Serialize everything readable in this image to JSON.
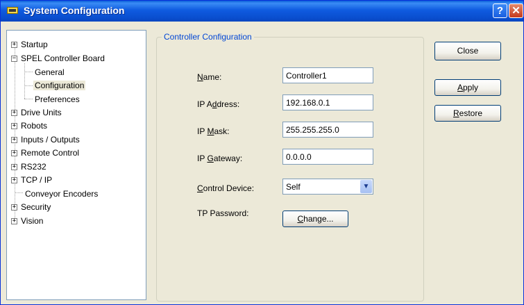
{
  "window": {
    "title": "System Configuration"
  },
  "tree": {
    "items": [
      {
        "label": "Startup",
        "expander": "+"
      },
      {
        "label": "SPEL Controller Board",
        "expander": "−"
      },
      {
        "label": "General"
      },
      {
        "label": "Configuration",
        "selected": true
      },
      {
        "label": "Preferences"
      },
      {
        "label": "Drive Units",
        "expander": "+"
      },
      {
        "label": "Robots",
        "expander": "+"
      },
      {
        "label": "Inputs / Outputs",
        "expander": "+"
      },
      {
        "label": "Remote Control",
        "expander": "+"
      },
      {
        "label": "RS232",
        "expander": "+"
      },
      {
        "label": "TCP / IP",
        "expander": "+"
      },
      {
        "label": "Conveyor Encoders"
      },
      {
        "label": "Security",
        "expander": "+"
      },
      {
        "label": "Vision",
        "expander": "+"
      }
    ]
  },
  "group": {
    "title": "Controller Configuration",
    "fields": {
      "name": {
        "label_pre": "",
        "label_u": "N",
        "label_post": "ame:",
        "value": "Controller1"
      },
      "ip_address": {
        "label_pre": "IP A",
        "label_u": "d",
        "label_post": "dress:",
        "value": "192.168.0.1"
      },
      "ip_mask": {
        "label_pre": "IP ",
        "label_u": "M",
        "label_post": "ask:",
        "value": "255.255.255.0"
      },
      "ip_gateway": {
        "label_pre": "IP ",
        "label_u": "G",
        "label_post": "ateway:",
        "value": "0.0.0.0"
      },
      "control_device": {
        "label_pre": "",
        "label_u": "C",
        "label_post": "ontrol Device:",
        "value": "Self"
      },
      "tp_password": {
        "label": "TP Password:",
        "button_pre": "",
        "button_u": "C",
        "button_post": "hange..."
      }
    }
  },
  "buttons": {
    "close": "Close",
    "apply": {
      "pre": "",
      "u": "A",
      "post": "pply"
    },
    "restore": {
      "pre": "",
      "u": "R",
      "post": "estore"
    }
  }
}
